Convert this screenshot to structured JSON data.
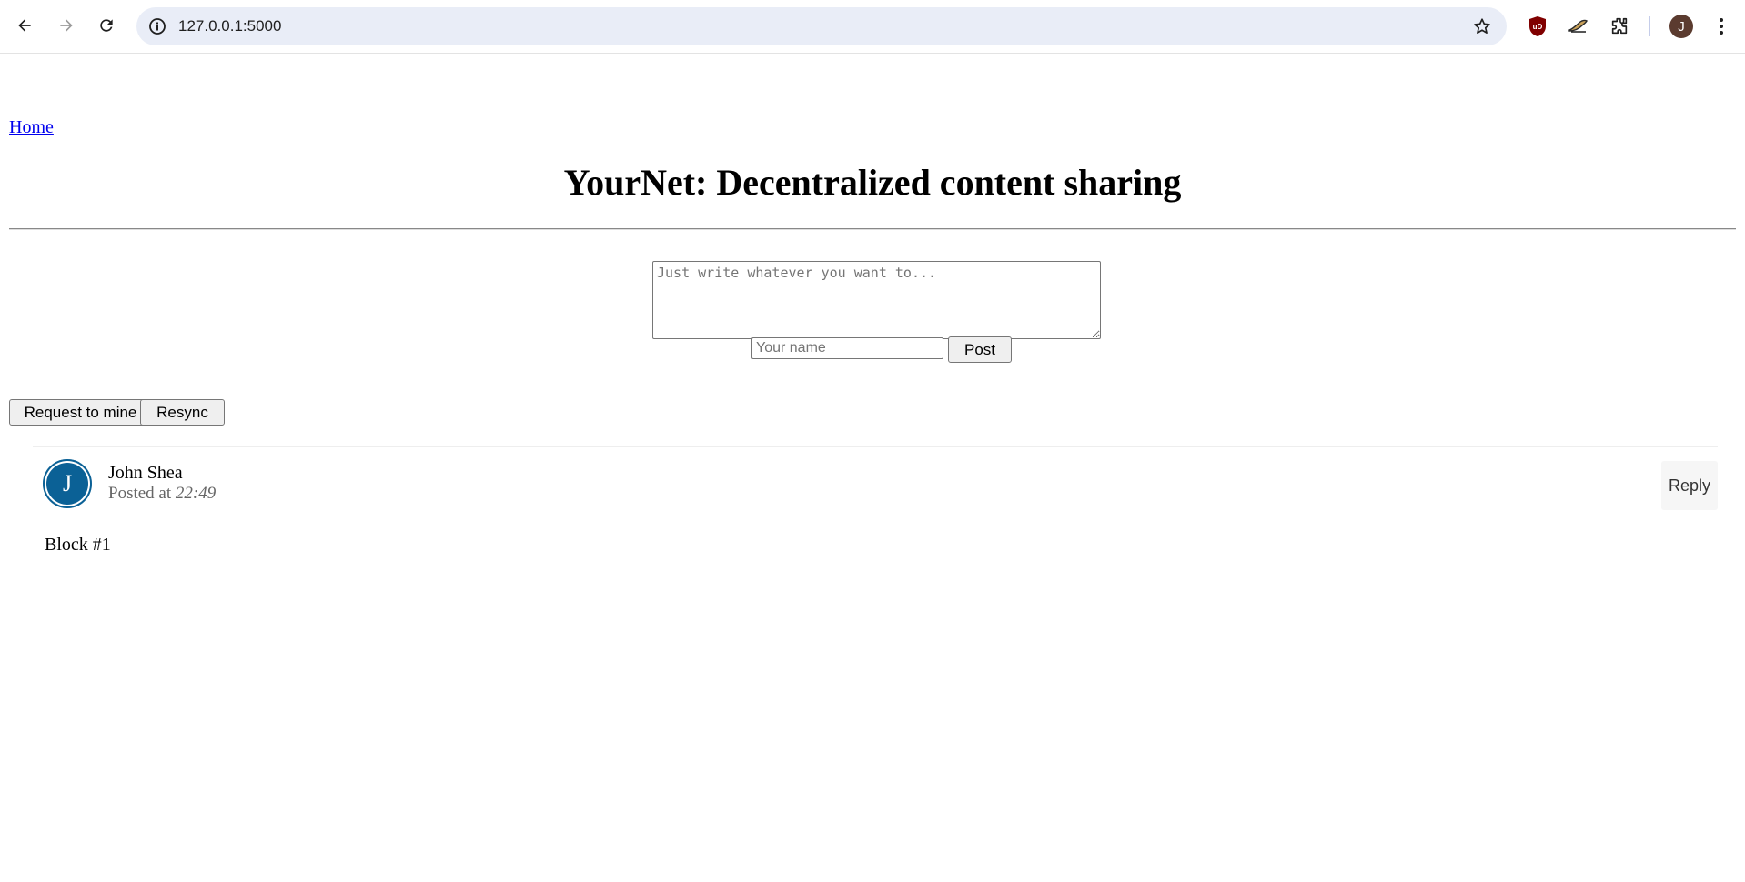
{
  "browser": {
    "url": "127.0.0.1:5000",
    "profile_initial": "J",
    "icons": [
      "back-arrow-icon",
      "forward-arrow-icon",
      "reload-icon",
      "site-info-icon",
      "bookmark-star-icon",
      "ublock-icon",
      "extension-icon",
      "puzzle-icon",
      "kebab-menu-icon"
    ]
  },
  "page": {
    "home_link": "Home",
    "title": "YourNet: Decentralized content sharing",
    "composer": {
      "textarea_placeholder": "Just write whatever you want to...",
      "name_placeholder": "Your name",
      "post_label": "Post"
    },
    "actions": {
      "mine_label": "Request to mine",
      "resync_label": "Resync"
    },
    "posts": [
      {
        "avatar_initial": "J",
        "author": "John Shea",
        "posted_prefix": "Posted at",
        "time": "22:49",
        "reply_label": "Reply",
        "content": "Block #1"
      }
    ]
  },
  "colors": {
    "avatar_bg": "#0b6196",
    "link": "#0000ee",
    "omnibox_bg": "#e9edf7"
  }
}
